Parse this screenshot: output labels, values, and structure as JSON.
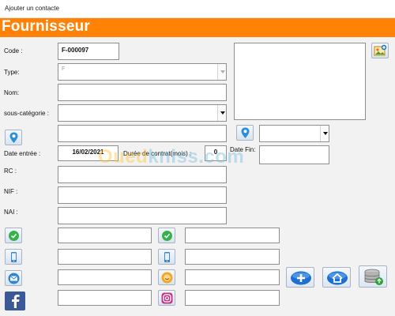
{
  "window": {
    "title": "Ajouter un contacte"
  },
  "banner": {
    "title": "Fournisseur",
    "color": "#ff8207"
  },
  "form": {
    "code_label": "Code :",
    "code_value": "F-000097",
    "type_label": "Type:",
    "type_value": "F",
    "nom_label": "Nom:",
    "nom_value": "",
    "souscat_label": "sous-catégorie :",
    "souscat_value": "",
    "address_value": "",
    "location_select_value": "",
    "date_entree_label": "Date entrée :",
    "date_entree_value": "16/02/2021",
    "duree_label": "Durée de contrat(mois) :",
    "duree_value": "0",
    "date_fin_label": "Date Fin:",
    "date_fin_value": "",
    "rc_label": "RC :",
    "rc_value": "",
    "nif_label": "NIF :",
    "nif_value": "",
    "nai_label": "NAI :",
    "nai_value": ""
  },
  "contacts": {
    "whatsapp_1": "",
    "whatsapp_2": "",
    "phone_1": "",
    "phone_2": "",
    "email": "",
    "skype": "",
    "facebook": "",
    "instagram": ""
  },
  "icons": {
    "add_photo": "photo-add-icon",
    "location_1": "map-pin-icon",
    "location_2": "map-pin-icon",
    "whatsapp": "whatsapp-icon",
    "phone": "phone-icon",
    "email": "email-icon",
    "skype": "skype-icon",
    "facebook": "facebook-icon",
    "instagram": "instagram-icon",
    "add": "add-icon",
    "home": "home-icon",
    "save": "database-save-icon"
  },
  "watermark": {
    "part1": "Oued",
    "part2": "kniss",
    "part3": ".com"
  }
}
